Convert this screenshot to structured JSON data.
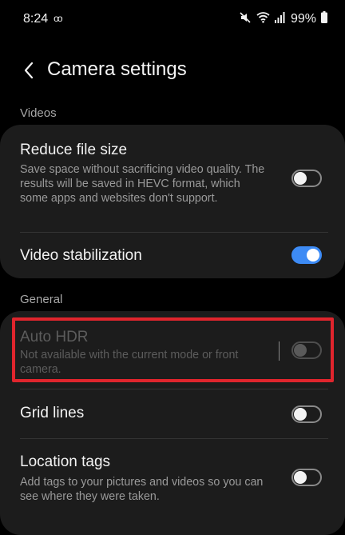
{
  "status_bar": {
    "time": "8:24",
    "voicemail_glyph": "oo",
    "battery": "99%",
    "icons": [
      "mute-icon",
      "wifi-icon",
      "signal-icon",
      "battery-icon"
    ]
  },
  "header": {
    "title": "Camera settings",
    "back_icon": "chevron-left-icon"
  },
  "videos_section": {
    "label": "Videos",
    "items": [
      {
        "title": "Reduce file size",
        "description": "Save space without sacrificing video quality. The results will be saved in HEVC format, which some apps and websites don't support.",
        "enabled": false
      },
      {
        "title": "Video stabilization",
        "enabled": true
      }
    ]
  },
  "general_section": {
    "label": "General",
    "items": [
      {
        "title": "Auto HDR",
        "description": "Not available with the current mode or front camera.",
        "enabled": false,
        "disabled": true
      },
      {
        "title": "Grid lines",
        "enabled": false
      },
      {
        "title": "Location tags",
        "description": "Add tags to your pictures and videos so you can see where they were taken.",
        "enabled": false
      }
    ]
  },
  "colors": {
    "background": "#000000",
    "card": "#1c1c1c",
    "toggle_on": "#3d8bf5",
    "highlight": "#e0252d"
  }
}
